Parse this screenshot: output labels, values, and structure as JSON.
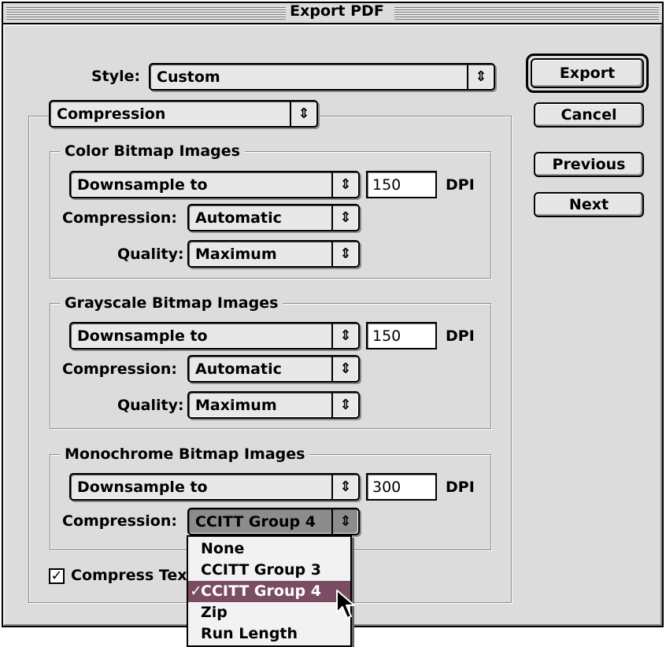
{
  "window": {
    "title": "Export PDF"
  },
  "style": {
    "label": "Style:",
    "value": "Custom"
  },
  "section_select": {
    "value": "Compression"
  },
  "buttons": {
    "export": "Export",
    "cancel": "Cancel",
    "previous": "Previous",
    "next": "Next"
  },
  "color_bitmap": {
    "title": "Color Bitmap Images",
    "sampling": "Downsample to",
    "dpi_value": "150",
    "dpi_unit": "DPI",
    "compression_label": "Compression:",
    "compression_value": "Automatic",
    "quality_label": "Quality:",
    "quality_value": "Maximum"
  },
  "grayscale_bitmap": {
    "title": "Grayscale Bitmap Images",
    "sampling": "Downsample to",
    "dpi_value": "150",
    "dpi_unit": "DPI",
    "compression_label": "Compression:",
    "compression_value": "Automatic",
    "quality_label": "Quality:",
    "quality_value": "Maximum"
  },
  "monochrome_bitmap": {
    "title": "Monochrome Bitmap Images",
    "sampling": "Downsample to",
    "dpi_value": "300",
    "dpi_unit": "DPI",
    "compression_label": "Compression:",
    "compression_value": "CCITT Group 4"
  },
  "compress_text": {
    "label": "Compress Tex",
    "checked": true
  },
  "compression_menu": {
    "items": [
      "None",
      "CCITT Group 3",
      "CCITT Group 4",
      "Zip",
      "Run Length"
    ],
    "selected_index": 2,
    "check_mark": "✓"
  },
  "icons": {
    "popup_arrow": "up-down-arrows-icon",
    "check": "check-icon",
    "cursor": "mouse-pointer-icon"
  },
  "colors": {
    "window_bg": "#dcdcdc",
    "menu_highlight": "#7a4d62"
  }
}
